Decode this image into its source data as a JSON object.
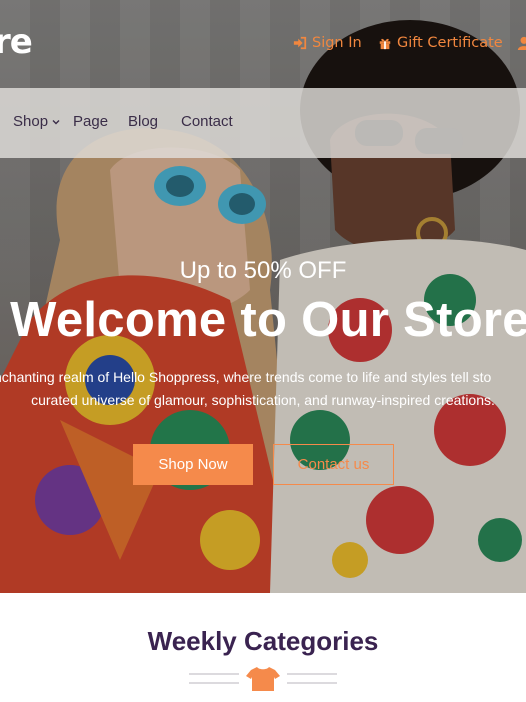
{
  "header": {
    "logo_text": "re",
    "signin_label": "Sign In",
    "gift_label": "Gift Certificate",
    "accent_color": "#f1873f"
  },
  "nav": {
    "items": [
      {
        "label": "Shop",
        "has_dropdown": true
      },
      {
        "label": "Page"
      },
      {
        "label": "Blog"
      },
      {
        "label": "Contact"
      }
    ]
  },
  "hero": {
    "kicker": "Up to 50% OFF",
    "headline": "Welcome to Our Store",
    "description_line1": "nchanting realm of Hello Shoppress, where trends come to life and styles tell sto",
    "description_line2": "curated universe of glamour, sophistication, and runway-inspired creations.",
    "primary_button": "Shop Now",
    "secondary_button": "Contact us"
  },
  "weekly": {
    "title": "Weekly Categories",
    "icon": "tshirt-icon"
  },
  "colors": {
    "accent": "#f58a4b",
    "heading": "#3a2350",
    "nav_text": "#3a2d48"
  }
}
